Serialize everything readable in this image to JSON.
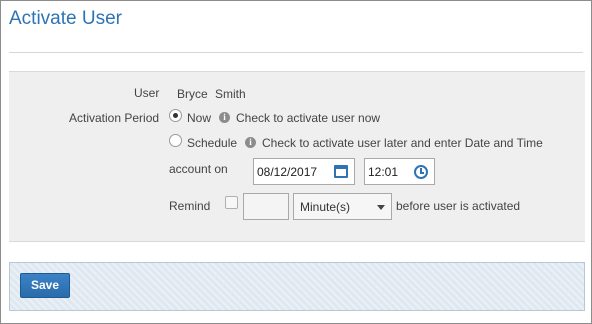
{
  "page": {
    "title": "Activate User"
  },
  "form": {
    "user_label": "User",
    "user_first_name": "Bryce",
    "user_last_name": "Smith",
    "activation_period_label": "Activation Period",
    "now_option": {
      "label": "Now",
      "hint": "Check to activate user now",
      "selected": true
    },
    "schedule_option": {
      "label": "Schedule",
      "hint": "Check to activate user later and enter Date and Time",
      "selected": false
    },
    "account_on_label": "account on",
    "date_value": "08/12/2017",
    "time_value": "12:01",
    "remind_label": "Remind",
    "remind_checked": false,
    "remind_amount": "",
    "remind_unit": "Minute(s)",
    "remind_suffix": "before user is activated"
  },
  "footer": {
    "save_label": "Save"
  },
  "icons": {
    "info": "info-icon",
    "calendar": "calendar-icon",
    "clock": "clock-icon",
    "dropdown": "chevron-down-icon"
  },
  "colors": {
    "title": "#2e74b5",
    "accent": "#2e74b5",
    "save_button": "#2a6cab"
  }
}
